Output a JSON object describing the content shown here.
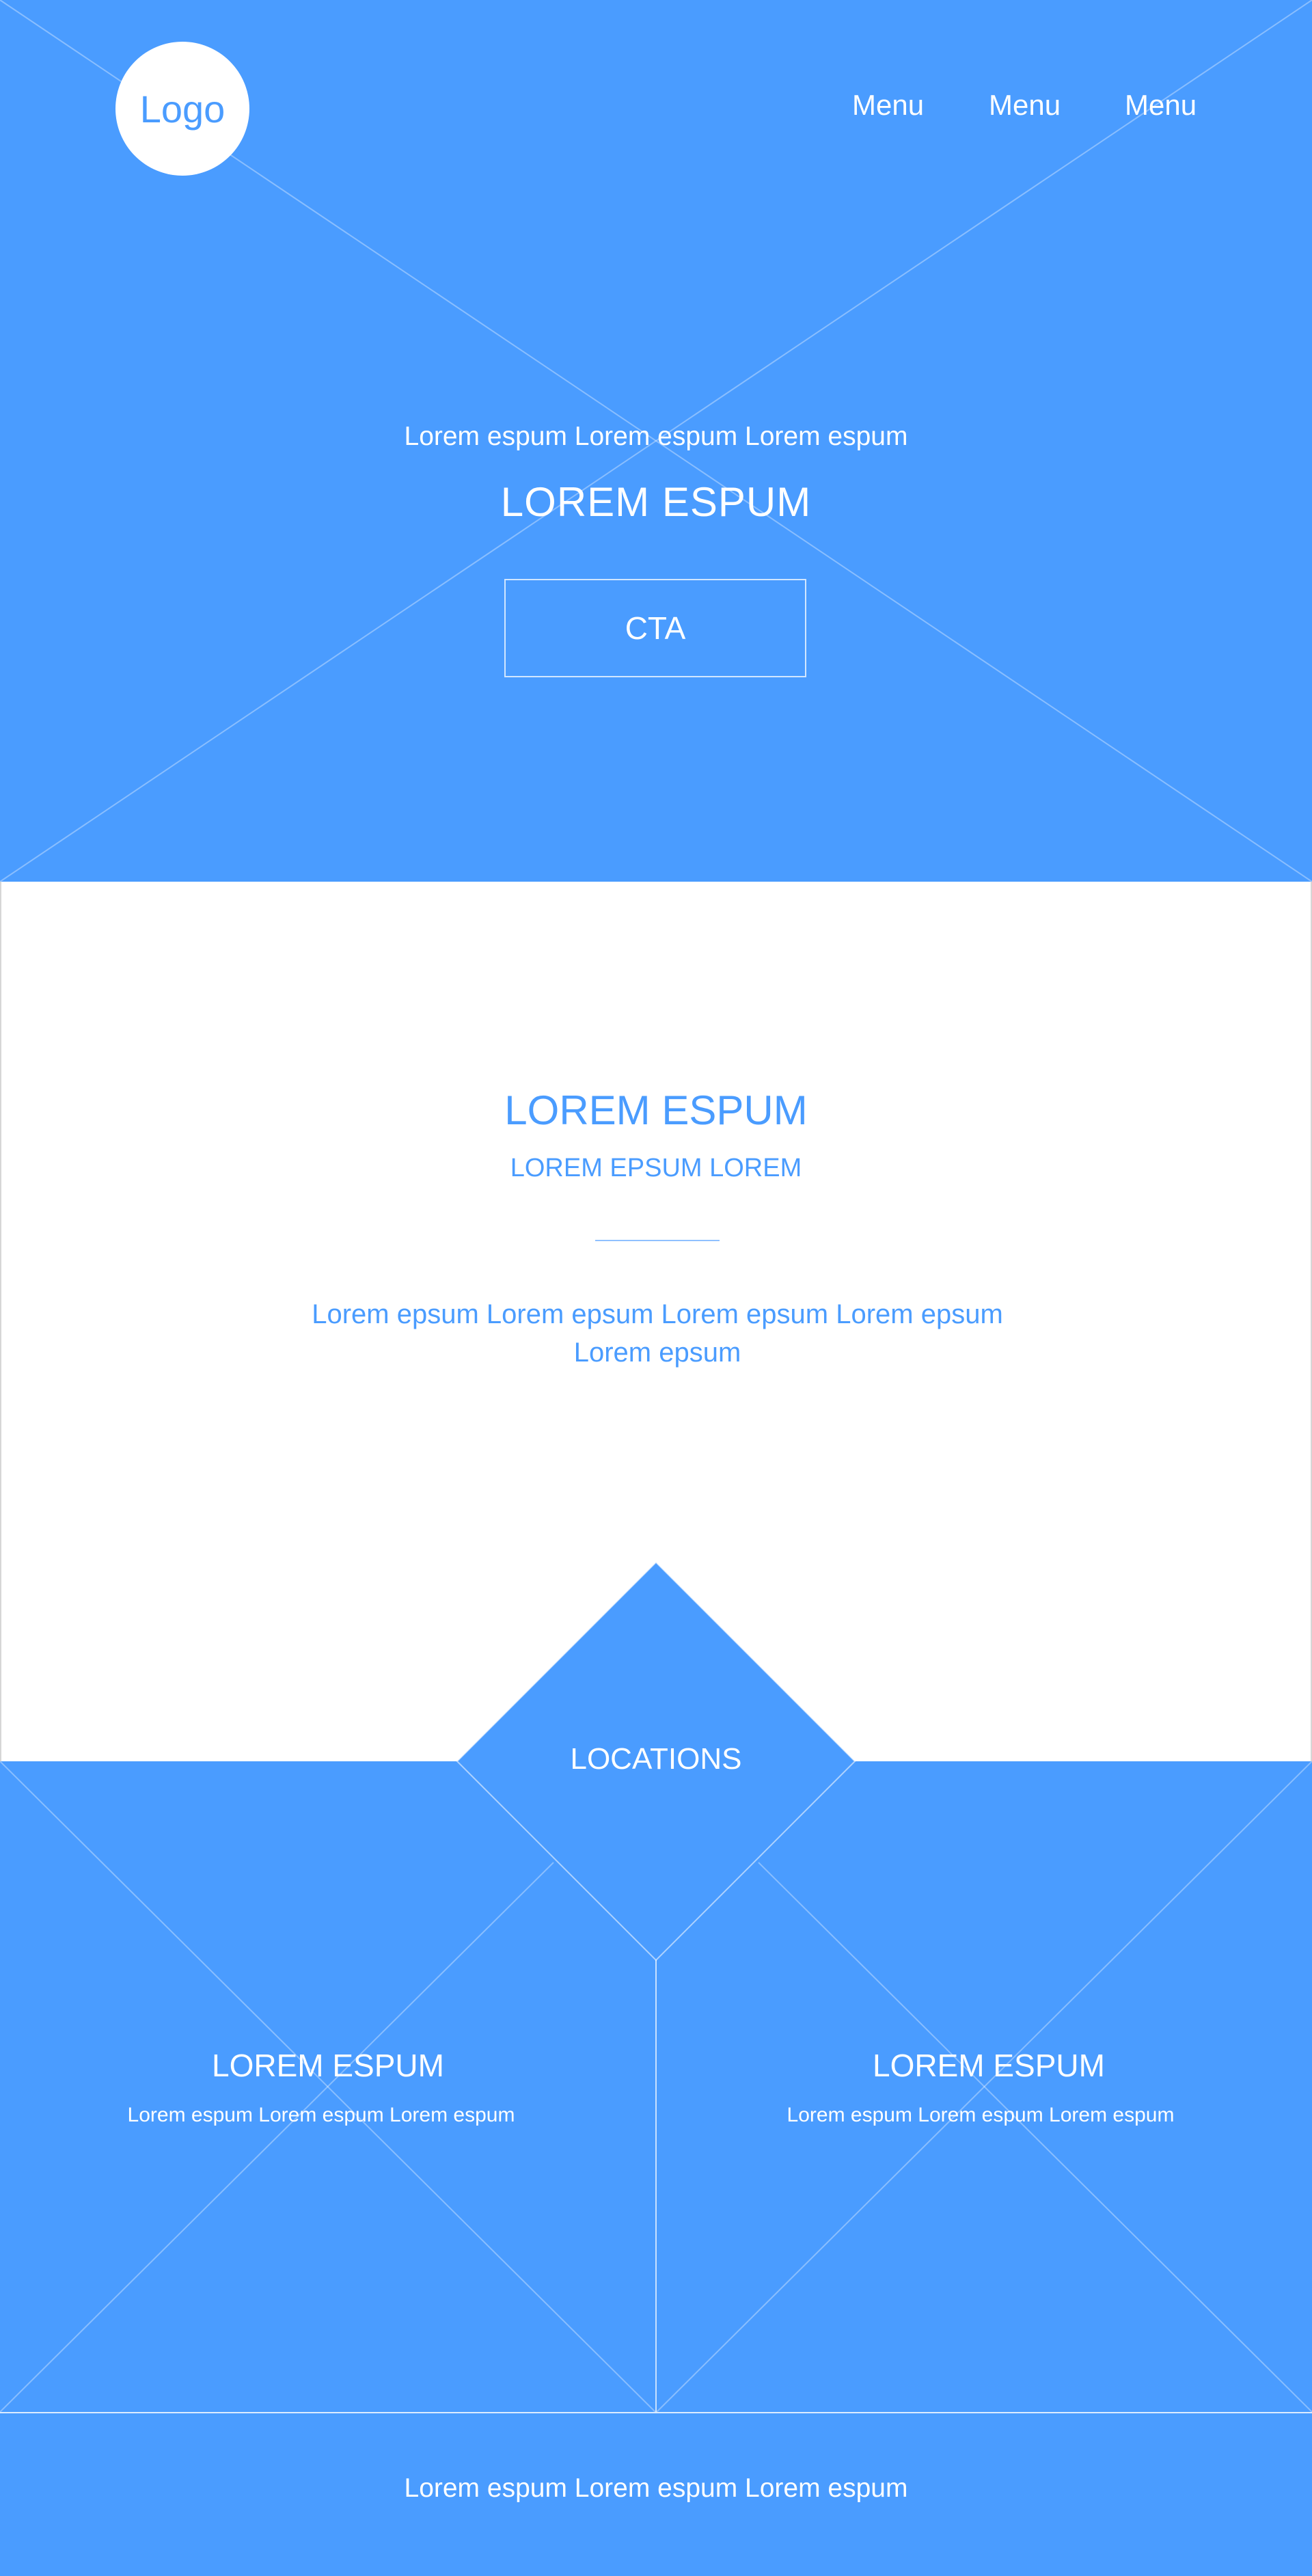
{
  "header": {
    "logo_label": "Logo",
    "menu": [
      {
        "label": "Menu"
      },
      {
        "label": "Menu"
      },
      {
        "label": "Menu"
      }
    ]
  },
  "hero": {
    "subtitle": "Lorem espum Lorem espum Lorem espum",
    "title": "LOREM ESPUM",
    "cta_label": "CTA"
  },
  "about": {
    "title": "LOREM ESPUM",
    "subtitle": "LOREM EPSUM LOREM",
    "body_line1": "Lorem epsum Lorem epsum Lorem epsum Lorem epsum",
    "body_line2": "Lorem epsum"
  },
  "locations": {
    "label": "LOCATIONS",
    "cards": [
      {
        "title": "LOREM ESPUM",
        "description": "Lorem espum Lorem espum Lorem espum"
      },
      {
        "title": "LOREM ESPUM",
        "description": "Lorem espum Lorem espum Lorem espum"
      }
    ]
  },
  "footer": {
    "text": "Lorem espum Lorem espum Lorem espum"
  },
  "colors": {
    "primary": "#4a9cff",
    "background": "#ffffff",
    "text_on_primary": "#ffffff"
  }
}
